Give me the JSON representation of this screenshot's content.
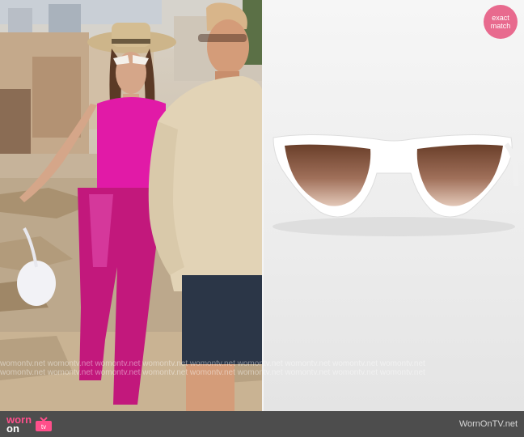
{
  "badge": {
    "line1": "exact",
    "line2": "match"
  },
  "footer": {
    "logo_word1": "worn",
    "logo_word2": "on",
    "logo_word3": "tv",
    "site": "WornOnTV.net"
  },
  "watermark": {
    "row1": "womontv.net  womontv.net  womontv.net  womontv.net  womontv.net  womontv.net  womontv.net  womontv.net  womontv.net",
    "row2": "womontv.net  womontv.net  womontv.net  womontv.net  womontv.net  womontv.net  womontv.net  womontv.net  womontv.net"
  },
  "colors": {
    "brand_pink": "#ff4f8b",
    "badge_pink": "#e86a8e",
    "footer_bg": "#4d4d4d",
    "top_pink": "#e11aa7",
    "pants_pink": "#c2187c"
  },
  "icons": {
    "tv": "tv-icon"
  }
}
